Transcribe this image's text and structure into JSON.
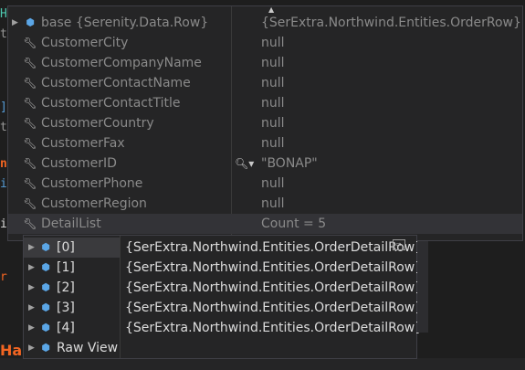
{
  "main_tip": {
    "rows": [
      {
        "name": "base {Serenity.Data.Row}",
        "value": "{SerExtra.Northwind.Entities.OrderRow}",
        "icon": "cube-icon",
        "expandable": true
      },
      {
        "name": "CustomerCity",
        "value": "null",
        "icon": "wrench-icon"
      },
      {
        "name": "CustomerCompanyName",
        "value": "null",
        "icon": "wrench-icon"
      },
      {
        "name": "CustomerContactName",
        "value": "null",
        "icon": "wrench-icon"
      },
      {
        "name": "CustomerContactTitle",
        "value": "null",
        "icon": "wrench-icon"
      },
      {
        "name": "CustomerCountry",
        "value": "null",
        "icon": "wrench-icon"
      },
      {
        "name": "CustomerFax",
        "value": "null",
        "icon": "wrench-icon"
      },
      {
        "name": "CustomerID",
        "value": "\"BONAP\"",
        "icon": "wrench-icon",
        "visualizer": true
      },
      {
        "name": "CustomerPhone",
        "value": "null",
        "icon": "wrench-icon"
      },
      {
        "name": "CustomerRegion",
        "value": "null",
        "icon": "wrench-icon"
      },
      {
        "name": "DetailList",
        "value": "Count = 5",
        "icon": "wrench-icon",
        "highlighted": true
      }
    ]
  },
  "sub_tip": {
    "rows": [
      {
        "name": "[0]",
        "value": "{SerExtra.Northwind.Entities.OrderDetailRow}",
        "selected": true
      },
      {
        "name": "[1]",
        "value": "{SerExtra.Northwind.Entities.OrderDetailRow}"
      },
      {
        "name": "[2]",
        "value": "{SerExtra.Northwind.Entities.OrderDetailRow}"
      },
      {
        "name": "[3]",
        "value": "{SerExtra.Northwind.Entities.OrderDetailRow}"
      },
      {
        "name": "[4]",
        "value": "{SerExtra.Northwind.Entities.OrderDetailRow}"
      },
      {
        "name": "Raw View",
        "value": ""
      }
    ]
  },
  "background": {
    "edge_chars": [
      "H",
      "t",
      "]",
      "t",
      "n",
      "i",
      "i",
      "r"
    ],
    "bottom_text": "Ha"
  },
  "colors": {
    "tip_bg": "#252526",
    "text_dim": "#8a8a8a",
    "text": "#dcdcdc",
    "icon_blue": "#5ba6e6",
    "accent_orange": "#f26522"
  }
}
